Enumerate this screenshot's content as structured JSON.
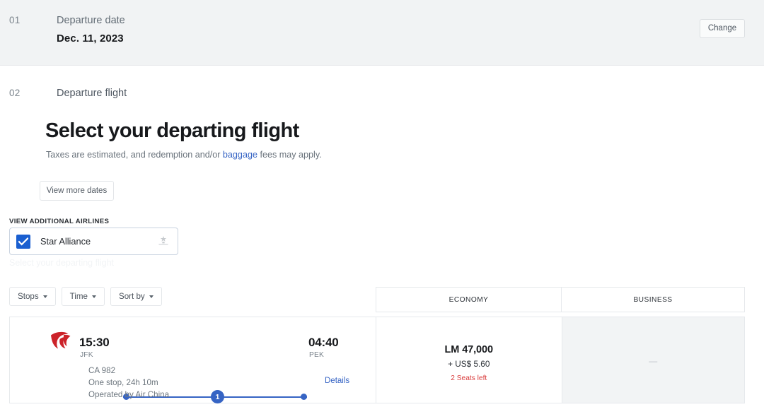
{
  "step_one": {
    "number": "01",
    "label": "Departure date",
    "value": "Dec. 11, 2023",
    "change_label": "Change"
  },
  "step_two": {
    "number": "02",
    "label": "Departure flight"
  },
  "main": {
    "title": "Select your departing flight",
    "subtitle_before": "Taxes are estimated, and redemption and/or ",
    "subtitle_link": "baggage",
    "subtitle_after": " fees may apply.",
    "view_more_dates_label": "View more dates",
    "ghost_text": "Select your departing flight"
  },
  "airlines_filter": {
    "section_label": "VIEW ADDITIONAL AIRLINES",
    "alliance_name": "Star Alliance",
    "checked": true,
    "logo_icon": "star-alliance-logo"
  },
  "filters": [
    {
      "label": "Stops",
      "name": "stops"
    },
    {
      "label": "Time",
      "name": "time"
    },
    {
      "label": "Sort by",
      "name": "sort-by"
    }
  ],
  "columns": [
    {
      "label": "ECONOMY"
    },
    {
      "label": "BUSINESS"
    }
  ],
  "flights": [
    {
      "airline_logo": "air-china-logo",
      "depart_time": "15:30",
      "depart_code": "JFK",
      "arrive_time": "04:40",
      "arrive_code": "PEK",
      "stops_count": "1",
      "flight_number": "CA 982",
      "duration": "One stop, 24h 10m",
      "operated_by": "Operated by Air China",
      "details_label": "Details",
      "economy": {
        "miles": "LM 47,000",
        "taxes": "+ US$ 5.60",
        "seats_left": "2 Seats left"
      },
      "business": {
        "value": "—"
      }
    }
  ],
  "colors": {
    "accent_blue": "#3664c4",
    "checkbox_blue": "#1a5fd0",
    "alert_red": "#d93b3b",
    "airline_red": "#cc2229",
    "band_grey": "#f1f3f4"
  }
}
